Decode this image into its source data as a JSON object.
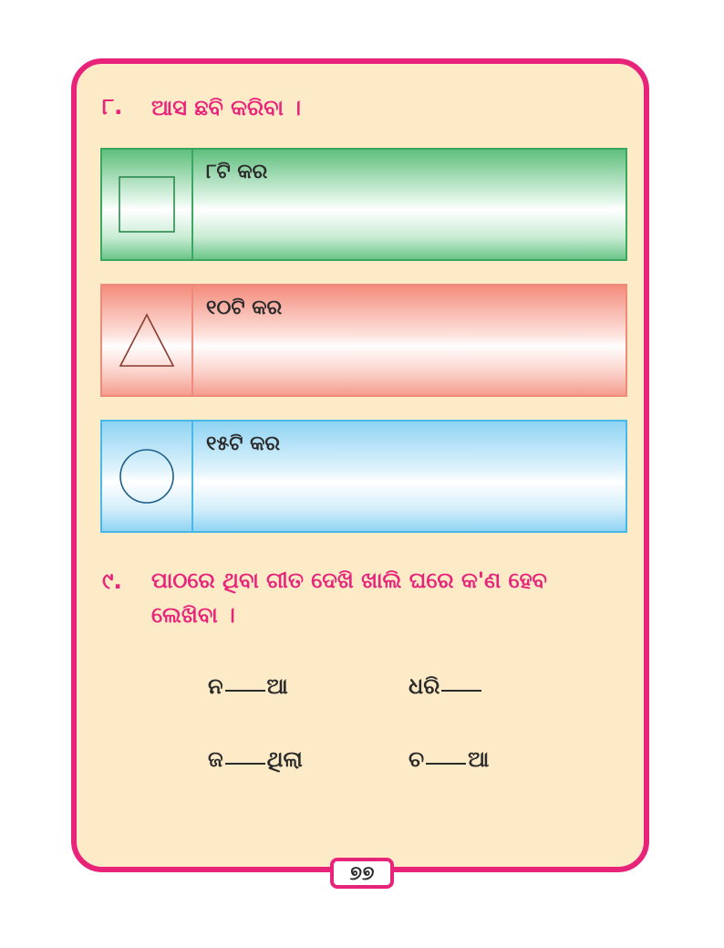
{
  "q8": {
    "number": "୮.",
    "title": "ଆସ ଛବି କରିବା ।",
    "tasks": [
      {
        "shape": "square-icon",
        "label": "୮ଟି କର",
        "color": "#3aa660"
      },
      {
        "shape": "triangle-icon",
        "label": "୧୦ଟି କର",
        "color": "#f08a7a"
      },
      {
        "shape": "circle-icon",
        "label": "୧୫ଟି କର",
        "color": "#49b8e6"
      }
    ]
  },
  "q9": {
    "number": "୯.",
    "line1": "ପାଠରେ ଥିବା ଗୀତ ଦେଖି ଖାଲି ଘରେ କ'ଣ ହେବ",
    "line2": "ଲେଖିବା ।",
    "items": [
      {
        "before": "ନ",
        "after": "ଆ"
      },
      {
        "before": "ଧରି",
        "after": ""
      },
      {
        "before": "ଜ",
        "after": "ଥିଲା"
      },
      {
        "before": "ଚ",
        "after": "ଆ"
      }
    ]
  },
  "page_number": "୭୭",
  "colors": {
    "accent": "#e8247a",
    "card_bg": "#fdebc8"
  }
}
